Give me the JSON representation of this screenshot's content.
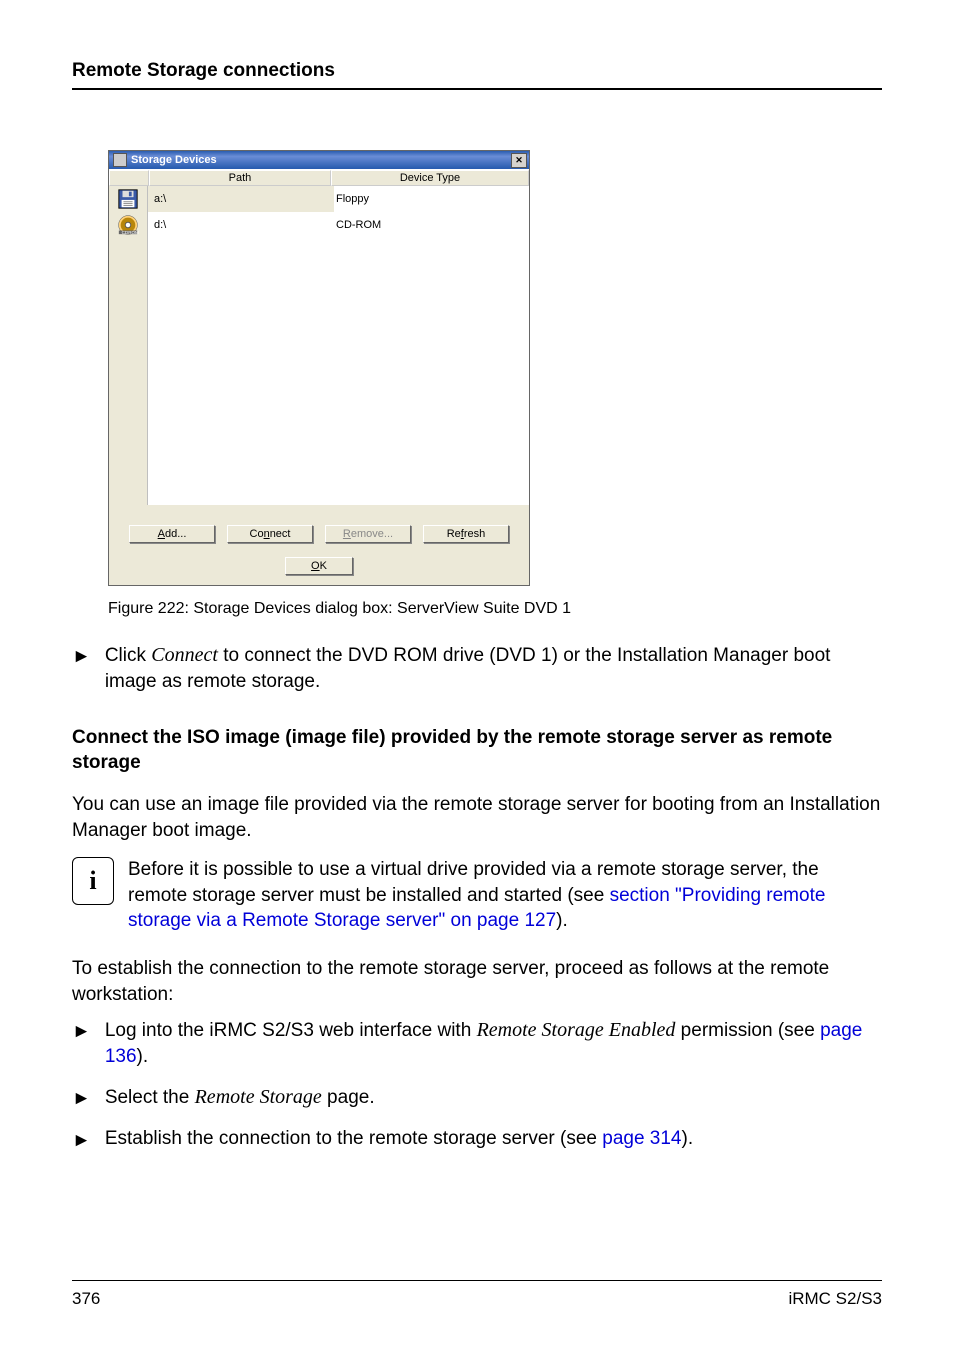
{
  "header": "Remote Storage connections",
  "dialog": {
    "title": "Storage Devices",
    "columns": {
      "path": "Path",
      "type": "Device Type"
    },
    "rows": [
      {
        "path": "a:\\",
        "type": "Floppy",
        "icon": "floppy"
      },
      {
        "path": "d:\\",
        "type": "CD-ROM",
        "icon": "cdrom"
      }
    ],
    "buttons": {
      "add": {
        "pre": "A",
        "rest": "dd..."
      },
      "connect": {
        "mid_pre": "Co",
        "ul": "n",
        "mid_post": "nect"
      },
      "remove": {
        "pre": "R",
        "rest": "emove..."
      },
      "refresh": {
        "pre": "Re",
        "ul": "f",
        "post": "resh"
      },
      "ok": {
        "pre": "O",
        "rest": "K"
      }
    }
  },
  "caption": "Figure 222:  Storage Devices dialog box: ServerView Suite DVD 1",
  "step_connect_pre": "Click ",
  "step_connect_italic": "Connect",
  "step_connect_post": " to connect the DVD ROM drive (DVD 1) or the Installation Manager boot image as remote storage.",
  "subheading": "Connect the ISO image (image file) provided by the remote storage server as remote storage",
  "para1": "You can use an image file provided via the remote storage server for booting from an Installation Manager boot image.",
  "info_pre": "Before it is possible to use a virtual drive provided via a remote storage server, the remote storage server must be installed and started (see ",
  "info_link": "section \"Providing remote storage via a Remote Storage server\" on page 127",
  "info_post": ").",
  "para2": "To establish the connection to the remote storage server, proceed as follows at the remote workstation:",
  "steps": {
    "s1_pre": "Log into the iRMC S2/S3 web interface with ",
    "s1_italic": "Remote Storage Enabled",
    "s1_post_a": " permission (see ",
    "s1_link": "page 136",
    "s1_post_b": ").",
    "s2_pre": "Select the ",
    "s2_italic": "Remote Storage",
    "s2_post": " page.",
    "s3_pre": "Establish the connection to the remote storage server (see ",
    "s3_link": "page 314",
    "s3_post": ")."
  },
  "footer": {
    "left": "376",
    "right": "iRMC S2/S3"
  }
}
